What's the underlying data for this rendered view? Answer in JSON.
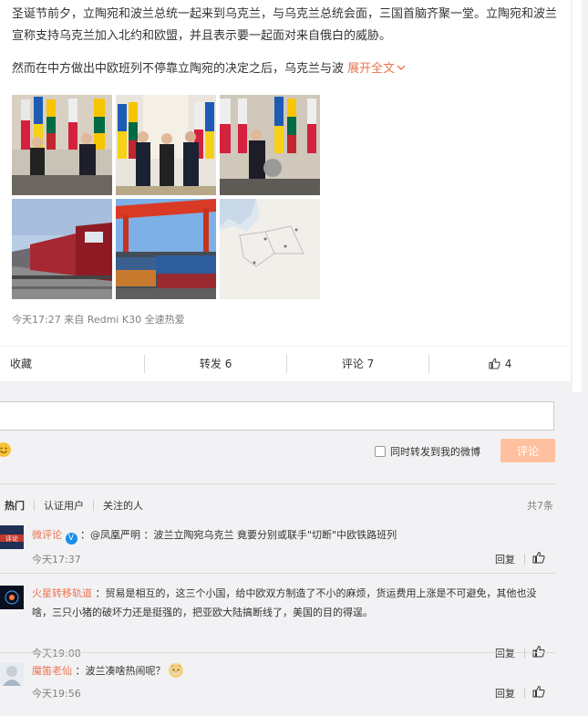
{
  "post": {
    "paragraph1": "圣诞节前夕，立陶宛和波兰总统一起来到乌克兰，与乌克兰总统会面，三国首脑齐聚一堂。立陶宛和波兰宣称支持乌克兰加入北约和欧盟，并且表示要一起面对来自俄白的威胁。",
    "paragraph2": "然而在中方做出中欧班列不停靠立陶宛的决定之后，乌克兰与波",
    "expand_label": "展开全文",
    "meta": "今天17:27  来自 Redmi K30 全速热爱"
  },
  "photos": [
    {
      "name": "photo-leaders-flags-1"
    },
    {
      "name": "photo-leaders-hall"
    },
    {
      "name": "photo-leaders-flags-2"
    },
    {
      "name": "photo-freight-train"
    },
    {
      "name": "photo-container-crane"
    },
    {
      "name": "photo-map"
    }
  ],
  "actions": {
    "favorite": "收藏",
    "repost": "转发 6",
    "comment": "评论 7",
    "like": "4"
  },
  "comment_box": {
    "sync_label": "同时转发到我的微博",
    "submit_label": "评论"
  },
  "filters": {
    "hot": "热门",
    "verified": "认证用户",
    "following": "关注的人",
    "total": "共7条"
  },
  "comments": [
    {
      "user": "微评论",
      "text": "：@凤凰严明 ：波兰立陶宛乌克兰 竟要分别或联手\"切断\"中欧铁路班列",
      "time": "今天17:37",
      "reply": "回复",
      "avatar_text": "微评论"
    },
    {
      "user": "火星转移轨道",
      "text": "：贸易是相互的，这三个小国，给中欧双方制造了不小的麻烦，货运费用上涨是不可避免，其他也没啥，三只小猪的破坏力还是挺强的，把亚欧大陆搞断线了，美国的目的得逞。",
      "time": "今天19:08",
      "reply": "回复"
    },
    {
      "user": "魔笛老仙",
      "text": "：波兰凑啥热闹呢？",
      "time": "今天19:56",
      "reply": "回复"
    }
  ]
}
